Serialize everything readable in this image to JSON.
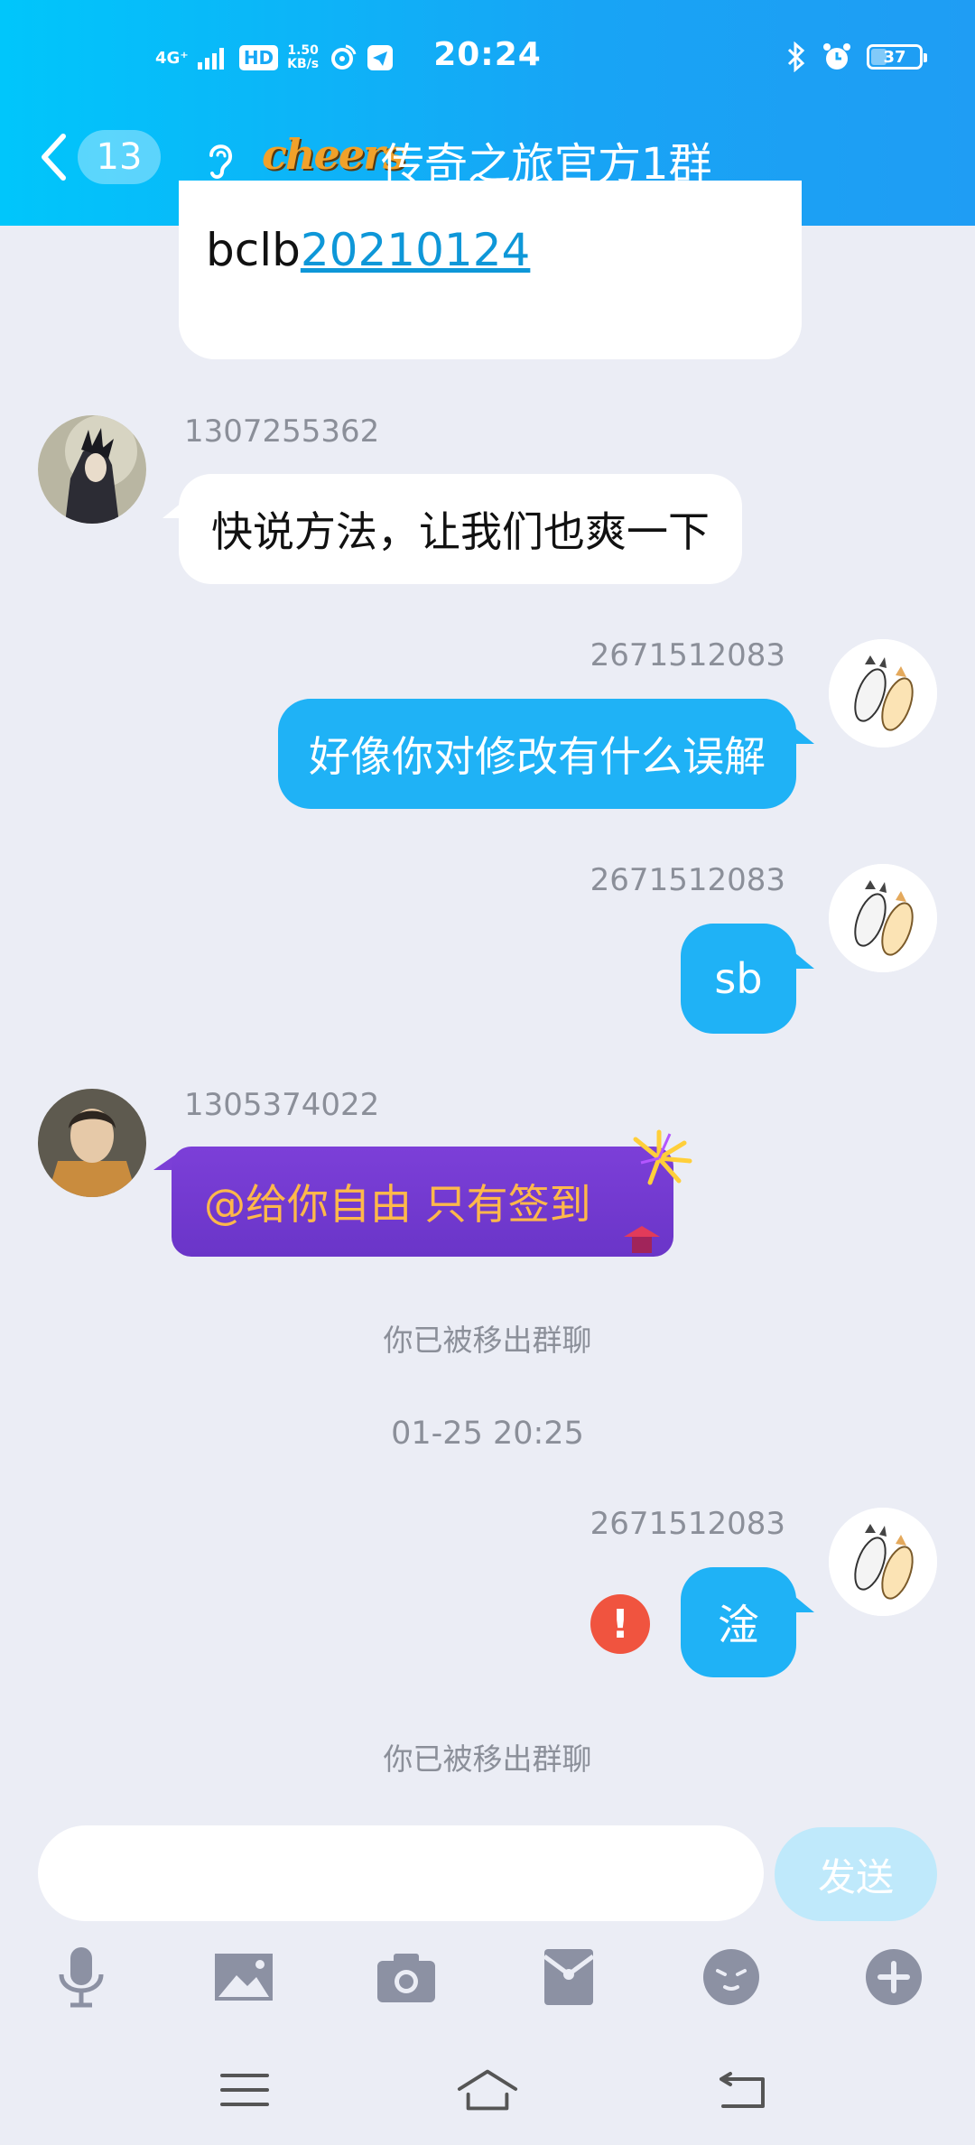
{
  "status_bar": {
    "network": "4G⁺",
    "hd": "HD",
    "speed_value": "1.50",
    "speed_unit": "KB/s",
    "time": "20:24",
    "battery": "37"
  },
  "nav": {
    "unread_count": "13",
    "logo_text": "cheers",
    "title": "传奇之旅官方1群"
  },
  "messages": [
    {
      "id": "m0",
      "side": "left",
      "text_prefix": "bclb",
      "link_text": "20210124"
    },
    {
      "id": "m1",
      "side": "left",
      "sender": "1307255362",
      "text": "快说方法，让我们也爽一下"
    },
    {
      "id": "m2",
      "side": "right",
      "sender": "2671512083",
      "text": "好像你对修改有什么误解"
    },
    {
      "id": "m3",
      "side": "right",
      "sender": "2671512083",
      "text": "sb"
    },
    {
      "id": "m4",
      "side": "left",
      "sender": "1305374022",
      "text": "@给你自由  只有签到"
    },
    {
      "id": "s1",
      "system": "你已被移出群聊"
    },
    {
      "id": "s2",
      "system": "01-25 20:25"
    },
    {
      "id": "m5",
      "side": "right",
      "sender": "2671512083",
      "text": "淦",
      "failed": true
    },
    {
      "id": "s3",
      "system": "你已被移出群聊"
    }
  ],
  "input": {
    "value": "",
    "send_label": "发送"
  },
  "toolbar": [
    "microphone-icon",
    "image-icon",
    "camera-icon",
    "red-packet-icon",
    "emoji-icon",
    "plus-icon"
  ],
  "colors": {
    "header_start": "#00c6fb",
    "header_end": "#1f9df4",
    "bubble_self": "#1fb2f6",
    "bubble_other": "#ffffff",
    "purple_bubble": "#7b3fd6",
    "purple_text": "#ffb84a",
    "error": "#f0543f",
    "background": "#ebedf5"
  }
}
